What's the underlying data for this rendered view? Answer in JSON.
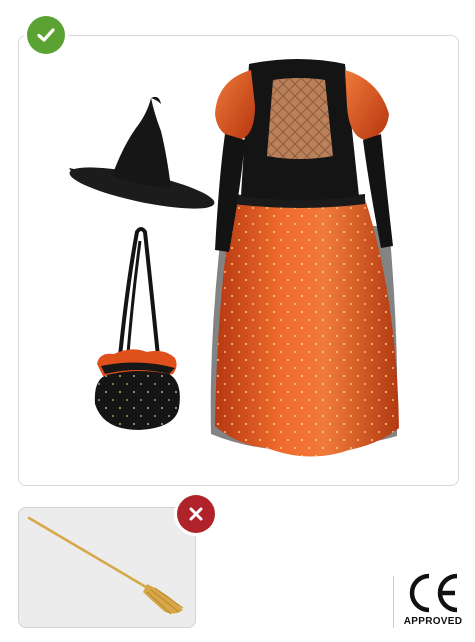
{
  "included": {
    "badge_icon": "check-icon",
    "badge_color": "#5aa232",
    "items": [
      "witch-hat",
      "witch-dress",
      "witch-handbag"
    ]
  },
  "excluded": {
    "badge_icon": "close-icon",
    "badge_color": "#b0232a",
    "items": [
      "broomstick"
    ]
  },
  "certification": {
    "mark": "CE",
    "label": "APPROVED"
  },
  "colors": {
    "dress_orange": "#e0501c",
    "dress_black": "#151515",
    "bodice_gold": "#b9805a"
  }
}
